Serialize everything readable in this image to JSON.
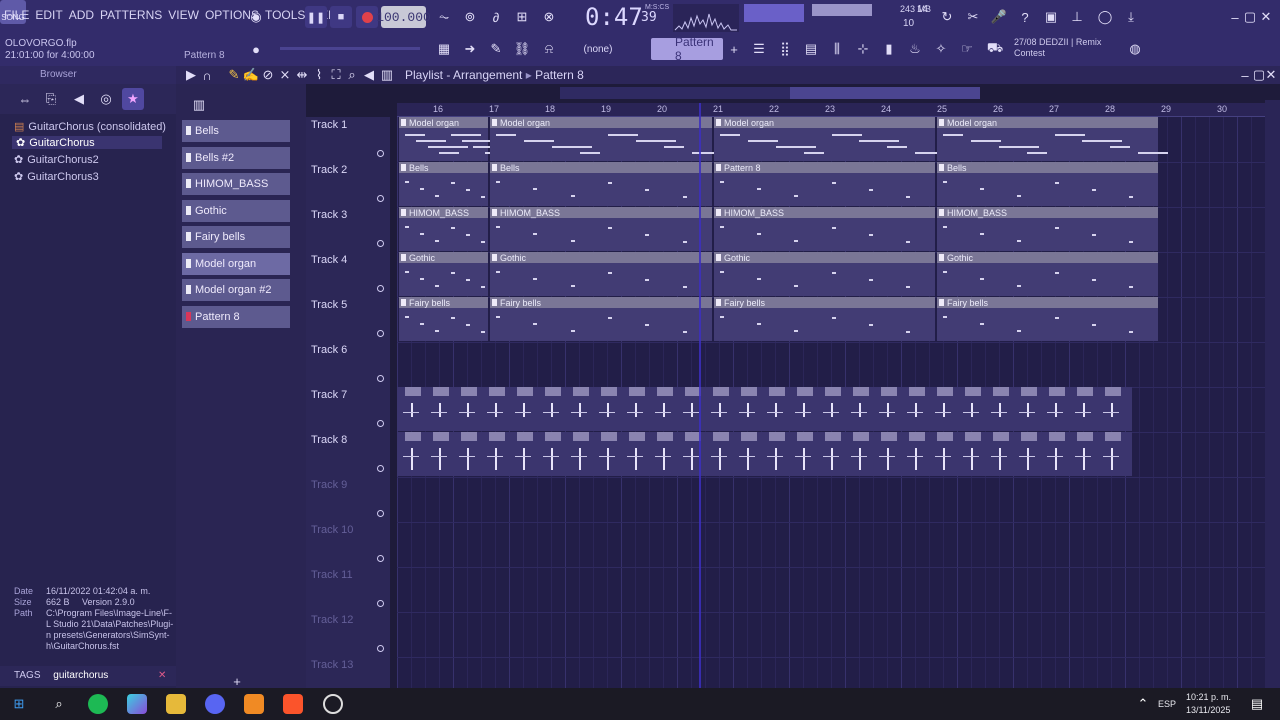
{
  "menu": [
    "FILE",
    "EDIT",
    "ADD",
    "PATTERNS",
    "VIEW",
    "OPTIONS",
    "TOOLS",
    "HELP"
  ],
  "project": {
    "name": "OLOVORGO.flp",
    "time": "21:01:00 for 4:00:00",
    "pattern": "Pattern 8"
  },
  "transport": {
    "song_label": "SONG",
    "tempo": "100.000",
    "time_main": "0:47",
    "time_sub": "39",
    "time_unit": "M:S:CS",
    "cpu": "14",
    "mem": "243 MB",
    "voices": "10"
  },
  "toolbar": {
    "pattern_selector": "Pattern 8",
    "none_selector": "(none)"
  },
  "news": {
    "line1": "27/08  DEDZII | Remix",
    "line2": "Contest"
  },
  "browser": {
    "title": "Browser",
    "items": [
      {
        "label": "GuitarChorus (consolidated)",
        "selected": false
      },
      {
        "label": "GuitarChorus",
        "selected": true
      },
      {
        "label": "GuitarChorus2",
        "selected": false
      },
      {
        "label": "GuitarChorus3",
        "selected": false
      }
    ],
    "info": {
      "date_label": "Date",
      "date": "16/11/2022 01:42:04 a. m.",
      "size_label": "Size",
      "size": "662 B",
      "version": "Version 2.9.0",
      "path_label": "Path",
      "path_lines": [
        "C:\\Program Files\\Image-Line\\F-",
        "L Studio 21\\Data\\Patches\\Plugi-",
        "n presets\\Generators\\SimSynt-",
        "h\\GuitarChorus.fst"
      ]
    },
    "tags_label": "TAGS",
    "tags_value": "guitarchorus"
  },
  "picker": [
    "Bells",
    "Bells #2",
    "HIMOM_BASS",
    "Gothic",
    "Fairy bells",
    "Model organ",
    "Model organ #2",
    "Pattern 8"
  ],
  "playlist": {
    "title": "Playlist - Arrangement",
    "pattern": "Pattern 8",
    "ruler": [
      "16",
      "17",
      "18",
      "19",
      "20",
      "21",
      "22",
      "23",
      "24",
      "25",
      "26",
      "27",
      "28",
      "29",
      "30"
    ],
    "tracks": [
      "Track 1",
      "Track 2",
      "Track 3",
      "Track 4",
      "Track 5",
      "Track 6",
      "Track 7",
      "Track 8",
      "Track 9",
      "Track 10",
      "Track 11",
      "Track 12",
      "Track 13"
    ],
    "clips": {
      "row1": [
        "Model organ",
        "Model organ",
        "Model organ",
        "Model organ"
      ],
      "row2": [
        "Bells",
        "Bells",
        "Pattern 8",
        "Bells"
      ],
      "row3": [
        "HIMOM_BASS",
        "HIMOM_BASS",
        "HIMOM_BASS",
        "HIMOM_BASS"
      ],
      "row4": [
        "Gothic",
        "Gothic",
        "Gothic",
        "Gothic"
      ],
      "row5": [
        "Fairy bells",
        "Fairy bells",
        "Fairy bells",
        "Fairy bells"
      ]
    }
  },
  "taskbar": {
    "lang": "ESP",
    "time": "10:21 p. m.",
    "date": "13/11/2025"
  },
  "colors": {
    "bg": "#221e48",
    "topbar": "#332c6b",
    "accent": "#5d5a8f",
    "record": "#e0414a"
  }
}
